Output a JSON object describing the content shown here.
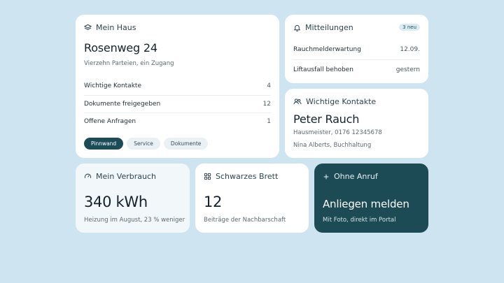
{
  "home": {
    "title": "Mein Haus",
    "address": "Rosenweg 24",
    "subtitle": "Vierzehn Parteien, ein Zugang",
    "rows": [
      {
        "label": "Wichtige Kontakte",
        "value": "4"
      },
      {
        "label": "Dokumente freigegeben",
        "value": "12"
      },
      {
        "label": "Offene Anfragen",
        "value": "1"
      }
    ],
    "chips": [
      "Pinnwand",
      "Service",
      "Dokumente"
    ],
    "active_chip": "Pinnwand",
    "icon": "layers-icon"
  },
  "messages": {
    "title": "Mitteilungen",
    "badge": "3 neu",
    "icon": "bell-icon",
    "items": [
      {
        "label": "Rauchmelderwartung",
        "value": "12.09."
      },
      {
        "label": "Liftausfall behoben",
        "value": "gestern"
      }
    ]
  },
  "contacts": {
    "title": "Wichtige Kontakte",
    "icon": "users-icon",
    "name": "Peter Rauch",
    "line1": "Hausmeister, 0176 12345678",
    "line2": "Nina Alberts, Buchhaltung"
  },
  "usage": {
    "title": "Mein Verbrauch",
    "icon": "gauge-icon",
    "value": "340 kWh",
    "note": "Heizung im August, 23 % weniger"
  },
  "board": {
    "title": "Schwarzes Brett",
    "icon": "grid-icon",
    "value": "12",
    "note": "Beiträge der Nachbarschaft"
  },
  "request": {
    "title": "Ohne Anruf",
    "icon": "plus-icon",
    "headline": "Anliegen melden",
    "note": "Mit Foto, direkt im Portal"
  },
  "colors": {
    "background": "#cfe4f1",
    "accent": "#1c4b55",
    "card": "#ffffff"
  }
}
